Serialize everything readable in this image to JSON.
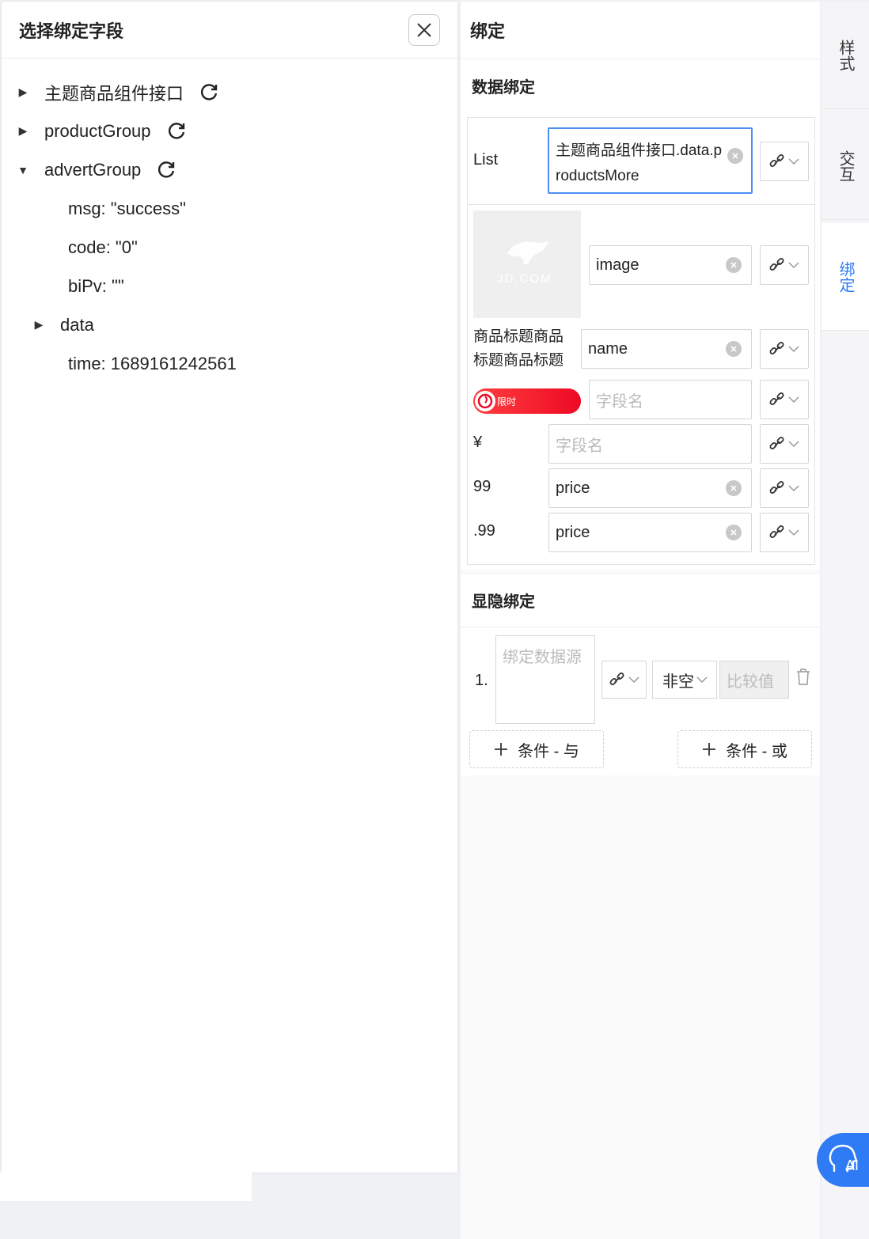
{
  "left_panel": {
    "title": "选择绑定字段",
    "tree": {
      "node1": "主题商品组件接口",
      "node2": "productGroup",
      "node3": "advertGroup",
      "msg": "msg: \"success\"",
      "code": "code: \"0\"",
      "bipv": "biPv: \"\"",
      "data": "data",
      "time": "time: 1689161242561"
    }
  },
  "right_panel": {
    "title": "绑定",
    "data_binding": {
      "title": "数据绑定",
      "list_label": "List",
      "list_value": "主题商品组件接口.data.productsMore",
      "image_value": "image",
      "image_watermark": "JD.COM",
      "title_label": "商品标题商品标题商品标题",
      "name_value": "name",
      "promo_text": "限时",
      "field_placeholder": "字段名",
      "currency_label": "¥",
      "int_label": "99",
      "price_value": "price",
      "dec_label": ".99",
      "price2_value": "price"
    },
    "visibility_binding": {
      "title": "显隐绑定",
      "index": "1.",
      "source_placeholder": "绑定数据源",
      "operator": "非空",
      "compare_placeholder": "比较值",
      "and_button": "条件 - 与",
      "or_button": "条件 - 或"
    }
  },
  "side_tabs": {
    "style": "样式",
    "interaction": "交互",
    "binding": "绑定",
    "active": "绑定"
  },
  "ai_button": "AI",
  "colors": {
    "accent": "#2f7bf5",
    "promo": "#ee0a24",
    "focus_border": "#4d8ef5"
  }
}
